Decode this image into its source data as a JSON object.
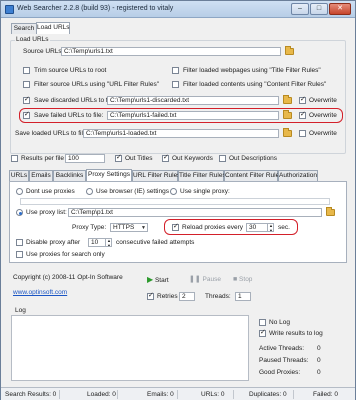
{
  "window": {
    "title": "Web Searcher 2.2.8 (build 93) - registered to vitaly",
    "minimize": "–",
    "maximize": "□",
    "close": "✕"
  },
  "top_tabs": [
    "Search",
    "Load URLs"
  ],
  "load_urls": {
    "group_title": "Load URLs",
    "source_label": "Source URLs:",
    "source_value": "C:\\Temp\\urls1.txt",
    "trim": "Trim source URLs to root",
    "filter_url_rules": "Filter source URLs using \"URL Filter Rules\"",
    "filter_title": "Filter loaded webpages using \"Title Filter Rules\"",
    "filter_content": "Filter loaded contents using \"Content Filter Rules\"",
    "save_discarded_label": "Save discarded URLs to file:",
    "save_discarded_value": "C:\\Temp\\urls1-discarded.txt",
    "save_failed_label": "Save failed URLs to file:",
    "save_failed_value": "C:\\Temp\\urls1-failed.txt",
    "overwrite": "Overwrite",
    "save_loaded_label": "Save loaded URLs to file:",
    "save_loaded_value": "C:\\Temp\\urls1-loaded.txt"
  },
  "results": {
    "per_file_label": "Results per file",
    "per_file_value": "100",
    "out_titles": "Out Titles",
    "out_keywords": "Out Keywords",
    "out_descriptions": "Out Descriptions"
  },
  "bottom_tabs": [
    "URLs",
    "Emails",
    "Backlinks",
    "Proxy Settings",
    "URL Filter Rules",
    "Title Filter Rules",
    "Content Filter Rules",
    "Authorization"
  ],
  "proxy": {
    "dont_use": "Dont use proxies",
    "use_browser": "Use browser (IE) settings",
    "use_single": "Use single proxy:",
    "use_list": "Use proxy list:",
    "list_value": "C:\\Temp\\p1.txt",
    "type_label": "Proxy Type:",
    "type_value": "HTTPS",
    "reload_label": "Reload proxies every",
    "reload_value": "30",
    "reload_unit": "sec.",
    "disable_label": "Disable proxy after",
    "disable_value": "10",
    "disable_suffix": "consecutive failed attempts",
    "search_only": "Use proxies for search only"
  },
  "footer": {
    "copyright": "Copyright (c) 2008-11 Opt-In Software",
    "website": "www.optinsoft.com",
    "start": "Start",
    "pause": "Pause",
    "stop": "Stop",
    "retries_label": "Retries",
    "retries_value": "2",
    "threads_label": "Threads:",
    "threads_value": "1"
  },
  "log": {
    "title": "Log",
    "no_log": "No Log",
    "write_results": "Write results to log",
    "active": "Active Threads:",
    "active_value": "0",
    "paused": "Paused Threads:",
    "paused_value": "0",
    "good": "Good Proxies:",
    "good_value": "0"
  },
  "statusbar": [
    {
      "label": "Search Results: 0"
    },
    {
      "label": "Loaded: 0"
    },
    {
      "label": "Emails: 0"
    },
    {
      "label": "URLs: 0"
    },
    {
      "label": "Duplicates: 0"
    },
    {
      "label": "Failed: 0"
    }
  ],
  "colors": {
    "highlight": "#d3202a",
    "accent": "#2e6fcc",
    "start_green": "#2c9a2c"
  }
}
